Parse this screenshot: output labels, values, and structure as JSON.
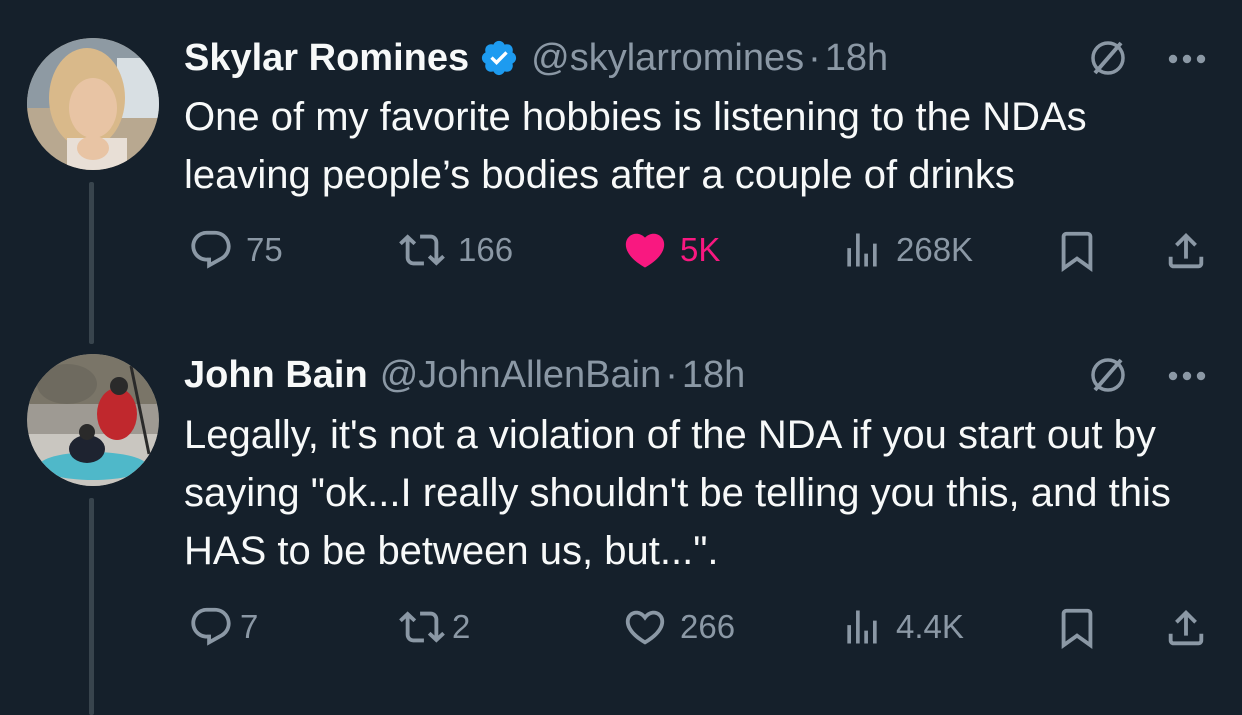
{
  "tweets": [
    {
      "name": "Skylar Romines",
      "verified": true,
      "handle": "@skylarromines",
      "separator": "·",
      "time": "18h",
      "text": "One of my favorite hobbies is listening to the NDAs leaving people’s bodies after a couple of drinks",
      "replies": "75",
      "retweets": "166",
      "likes": "5K",
      "liked": true,
      "views": "268K"
    },
    {
      "name": "John Bain",
      "verified": false,
      "handle": "@JohnAllenBain",
      "separator": "·",
      "time": "18h",
      "text": "Legally, it's not a violation of the NDA if you start out by saying \"ok...I really shouldn't be telling you this, and this HAS to be between us, but...\".",
      "replies": "7",
      "retweets": "2",
      "likes": "266",
      "liked": false,
      "views": "4.4K"
    }
  ],
  "colors": {
    "background": "#15202b",
    "text": "#f7f9f9",
    "secondary": "#8b98a5",
    "like": "#f91880",
    "verified": "#1d9bf0"
  }
}
